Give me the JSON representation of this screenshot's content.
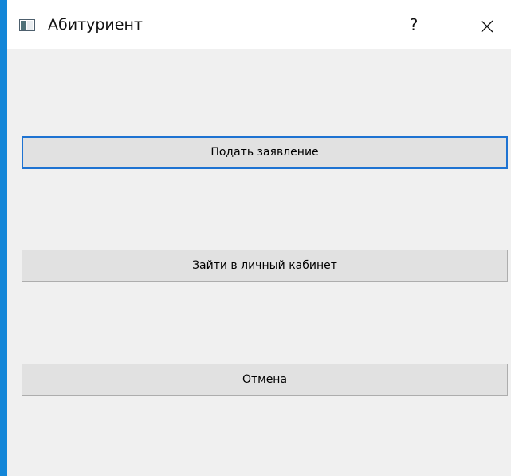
{
  "window": {
    "title": "Абитуриент",
    "help_label": "?"
  },
  "buttons": {
    "apply": "Подать заявление",
    "login": "Зайти в личный кабинет",
    "cancel": "Отмена"
  },
  "colors": {
    "desktop": "#1386d8",
    "dialog_background": "#f0f0f0",
    "titlebar": "#ffffff",
    "button_face": "#e1e1e1",
    "button_border": "#adadad",
    "focus_border": "#1e73d2"
  },
  "icons": {
    "app": "window-app-icon",
    "close": "close-icon"
  }
}
